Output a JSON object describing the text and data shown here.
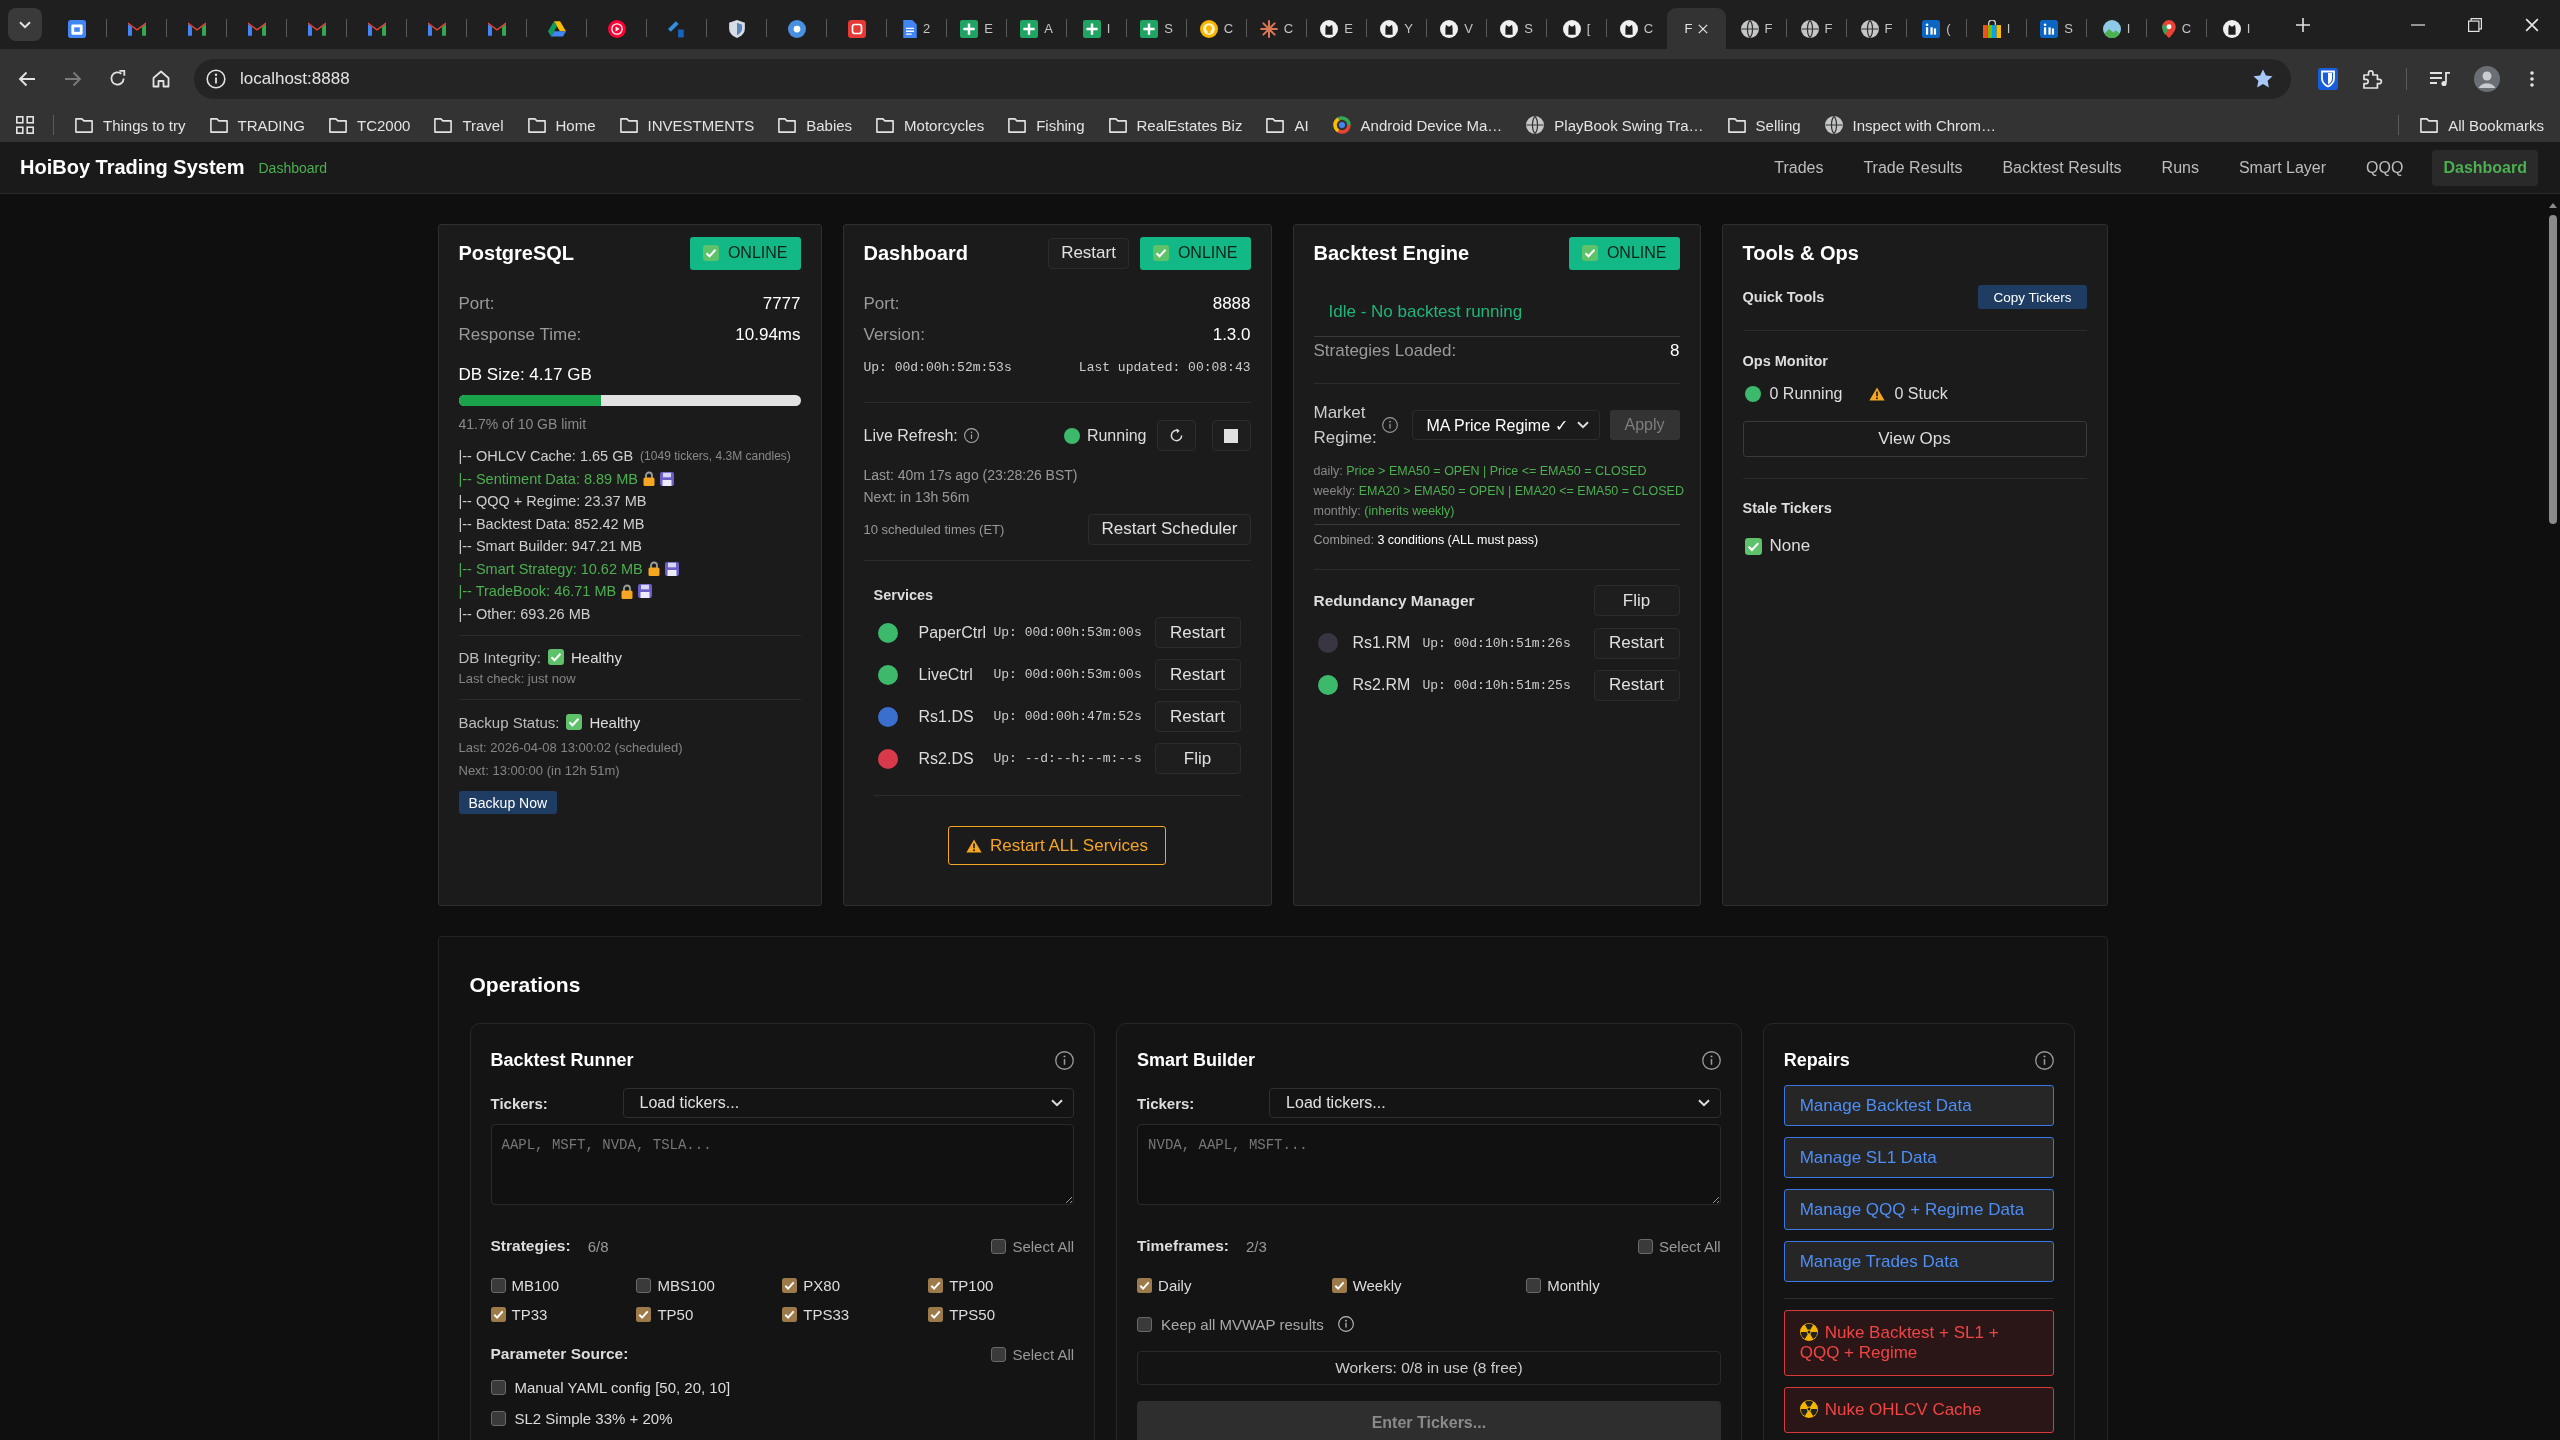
{
  "browser": {
    "tabs": [
      {
        "kind": "calendar",
        "selected": false
      },
      {
        "kind": "mail",
        "selected": false
      },
      {
        "kind": "mail",
        "selected": false
      },
      {
        "kind": "mail",
        "selected": false
      },
      {
        "kind": "mail",
        "selected": false
      },
      {
        "kind": "mail",
        "selected": false
      },
      {
        "kind": "mail",
        "selected": false
      },
      {
        "kind": "mail",
        "selected": false
      },
      {
        "kind": "triangle",
        "selected": false
      },
      {
        "kind": "play",
        "selected": false
      },
      {
        "kind": "corner",
        "selected": false
      },
      {
        "kind": "shield",
        "selected": false
      },
      {
        "kind": "disc",
        "selected": false
      },
      {
        "kind": "tile",
        "selected": false
      },
      {
        "kind": "document",
        "title": "2",
        "selected": false
      },
      {
        "kind": "sheet",
        "title": "E",
        "selected": false
      },
      {
        "kind": "sheet",
        "title": "A",
        "selected": false
      },
      {
        "kind": "sheet",
        "title": "I",
        "selected": false
      },
      {
        "kind": "sheet",
        "title": "S",
        "selected": false
      },
      {
        "kind": "bulb",
        "title": "C",
        "selected": false
      },
      {
        "kind": "sparkle",
        "title": "C",
        "selected": false
      },
      {
        "kind": "roundel",
        "title": "E",
        "selected": false
      },
      {
        "kind": "roundel",
        "title": "Y",
        "selected": false
      },
      {
        "kind": "roundel",
        "title": "V",
        "selected": false
      },
      {
        "kind": "roundel",
        "title": "S",
        "selected": false
      },
      {
        "kind": "roundel",
        "title": "[",
        "selected": false
      },
      {
        "kind": "roundel",
        "title": "C",
        "selected": false
      },
      {
        "title": "F",
        "selected": true
      },
      {
        "kind": "globe",
        "title": "F",
        "selected": false
      },
      {
        "kind": "globe",
        "title": "F",
        "selected": false
      },
      {
        "kind": "globe",
        "title": "F",
        "selected": false
      },
      {
        "kind": "box",
        "title": "(",
        "selected": false
      },
      {
        "kind": "bag",
        "title": "I",
        "selected": false
      },
      {
        "kind": "box",
        "title": "S",
        "selected": false
      },
      {
        "kind": "landscape",
        "title": "I",
        "selected": false
      },
      {
        "kind": "pin",
        "title": "C",
        "selected": false
      },
      {
        "kind": "roundel",
        "title": "I",
        "selected": false
      }
    ],
    "address": "localhost:8888",
    "bookmarks": [
      {
        "kind": "folder",
        "label": "Things to try"
      },
      {
        "kind": "folder",
        "label": "TRADING"
      },
      {
        "kind": "folder",
        "label": "TC2000"
      },
      {
        "kind": "folder",
        "label": "Travel"
      },
      {
        "kind": "folder",
        "label": "Home"
      },
      {
        "kind": "folder",
        "label": "INVESTMENTS"
      },
      {
        "kind": "folder",
        "label": "Babies"
      },
      {
        "kind": "folder",
        "label": "Motorcycles"
      },
      {
        "kind": "folder",
        "label": "Fishing"
      },
      {
        "kind": "folder",
        "label": "RealEstates Biz"
      },
      {
        "kind": "folder",
        "label": "AI"
      },
      {
        "kind": "ring",
        "label": "Android Device Ma…"
      },
      {
        "kind": "globe",
        "label": "PlayBook Swing Tra…"
      },
      {
        "kind": "folder",
        "label": "Selling"
      },
      {
        "kind": "globe",
        "label": "Inspect with Chrom…"
      }
    ],
    "all_bookmarks": {
      "kind": "folder",
      "label": "All Bookmarks"
    }
  },
  "header": {
    "title": "HoiBoy Trading System",
    "page": "Dashboard",
    "nav": [
      {
        "label": "Trades",
        "selected": false
      },
      {
        "label": "Trade Results",
        "selected": false
      },
      {
        "label": "Backtest Results",
        "selected": false
      },
      {
        "label": "Runs",
        "selected": false
      },
      {
        "label": "Smart Layer",
        "selected": false
      },
      {
        "label": "QQQ",
        "selected": false
      },
      {
        "label": "Dashboard",
        "selected": true
      }
    ]
  },
  "postgres": {
    "title": "PostgreSQL",
    "status": {
      "label": "ONLINE",
      "online": true
    },
    "stats": [
      {
        "label": "Port:",
        "value": "7777"
      },
      {
        "label": "Response Time:",
        "value": "10.94ms"
      }
    ],
    "db_size": "DB Size: 4.17 GB",
    "usage": {
      "level": 0.417,
      "caption": "41.7% of 10 GB limit"
    },
    "breakdown": [
      {
        "text": "|-- OHLCV Cache: 1.65 GB",
        "note": "(1049 tickers, 4.3M candles)",
        "protected": false
      },
      {
        "text": "|-- Sentiment Data: 8.89 MB",
        "protected": true
      },
      {
        "text": "|-- QQQ + Regime: 23.37 MB",
        "protected": false
      },
      {
        "text": "|-- Backtest Data: 852.42 MB",
        "protected": false
      },
      {
        "text": "|-- Smart Builder: 947.21 MB",
        "protected": false
      },
      {
        "text": "|-- Smart Strategy: 10.62 MB",
        "protected": true
      },
      {
        "text": "|-- TradeBook: 46.71 MB",
        "protected": true
      },
      {
        "text": "|-- Other: 693.26 MB",
        "protected": false
      }
    ],
    "integrity": {
      "label": "DB Integrity:",
      "ok": true,
      "value": "Healthy",
      "note": "Last check: just now"
    },
    "backup": {
      "label": "Backup Status:",
      "ok": true,
      "value": "Healthy",
      "lines": [
        "Last: 2026-04-08 13:00:02 (scheduled)",
        "Next: 13:00:00 (in 12h 51m)"
      ],
      "button": "Backup Now"
    }
  },
  "dashboard": {
    "title": "Dashboard",
    "restart": "Restart",
    "status": {
      "label": "ONLINE",
      "online": true
    },
    "stats": [
      {
        "label": "Port:",
        "value": "8888"
      },
      {
        "label": "Version:",
        "value": "1.3.0"
      }
    ],
    "uptime": "Up: 00d:00h:52m:53s",
    "updated": "Last updated: 00:08:43",
    "live_refresh": {
      "label": "Live Refresh:",
      "running": true,
      "state": "Running",
      "last": "Last: 40m 17s ago (23:28:26 BST)",
      "next": "Next: in 13h 56m",
      "schedule": "10 scheduled times (ET)",
      "button": "Restart Scheduler"
    },
    "services": {
      "title": "Services",
      "items": [
        {
          "name": "PaperCtrl",
          "uptime": "Up: 00d:00h:53m:00s",
          "color": "#3cb96b",
          "action": "Restart"
        },
        {
          "name": "LiveCtrl",
          "uptime": "Up: 00d:00h:53m:00s",
          "color": "#3cb96b",
          "action": "Restart"
        },
        {
          "name": "Rs1.DS",
          "uptime": "Up: 00d:00h:47m:52s",
          "color": "#3a6fd0",
          "action": "Restart"
        },
        {
          "name": "Rs2.DS",
          "uptime": "Up: --d:--h:--m:--s",
          "color": "#d93a4b",
          "action": "Flip"
        }
      ]
    },
    "restart_all": "Restart ALL Services"
  },
  "backtest_engine": {
    "title": "Backtest Engine",
    "status": {
      "label": "ONLINE",
      "online": true
    },
    "idle": "Idle - No backtest running",
    "strategies": {
      "label": "Strategies Loaded:",
      "value": "8"
    },
    "regime": {
      "label": "Market Regime:",
      "value": "MA Price Regime ✓",
      "apply": {
        "label": "Apply",
        "disabled": true
      },
      "rules": [
        {
          "label": "daily:",
          "text": "Price > EMA50 = OPEN | Price <= EMA50 = CLOSED"
        },
        {
          "label": "weekly:",
          "text": "EMA20 > EMA50 = OPEN | EMA20 <= EMA50 = CLOSED"
        },
        {
          "label": "monthly:",
          "text": "(inherits weekly)"
        }
      ],
      "combined": {
        "label": "Combined:",
        "value": "3 conditions (ALL must pass)"
      }
    },
    "redundancy": {
      "title": "Redundancy Manager",
      "action": "Flip",
      "items": [
        {
          "name": "Rs1.RM",
          "uptime": "Up: 00d:10h:51m:26s",
          "color": "#3a3542",
          "action": "Restart"
        },
        {
          "name": "Rs2.RM",
          "uptime": "Up: 00d:10h:51m:25s",
          "color": "#3cb96b",
          "action": "Restart"
        }
      ]
    }
  },
  "tools": {
    "title": "Tools & Ops",
    "quick_tools": {
      "label": "Quick Tools",
      "button": "Copy Tickers"
    },
    "ops_monitor": {
      "label": "Ops Monitor",
      "running": "0 Running",
      "stuck": "0 Stuck",
      "button": "View Ops"
    },
    "stale": {
      "label": "Stale Tickers",
      "ok": true,
      "value": "None"
    }
  },
  "operations": {
    "title": "Operations",
    "backtest_runner": {
      "title": "Backtest Runner",
      "tickers": {
        "label": "Tickers:",
        "select": "Load tickers...",
        "placeholder": "AAPL, MSFT, NVDA, TSLA..."
      },
      "strategies": {
        "label": "Strategies:",
        "count": "6/8",
        "select_all": {
          "label": "Select All",
          "checked": false
        },
        "items": [
          {
            "label": "MB100",
            "checked": false
          },
          {
            "label": "MBS100",
            "checked": false
          },
          {
            "label": "PX80",
            "checked": true
          },
          {
            "label": "TP100",
            "checked": true
          },
          {
            "label": "TP33",
            "checked": true
          },
          {
            "label": "TP50",
            "checked": true
          },
          {
            "label": "TPS33",
            "checked": true
          },
          {
            "label": "TPS50",
            "checked": true
          }
        ]
      },
      "param_source": {
        "label": "Parameter Source:",
        "select_all": {
          "label": "Select All",
          "checked": false
        },
        "items": [
          {
            "label": "Manual YAML config [50, 20, 10]",
            "checked": false
          },
          {
            "label": "SL2 Simple 33% + 20%",
            "checked": false
          }
        ]
      }
    },
    "smart_builder": {
      "title": "Smart Builder",
      "tickers": {
        "label": "Tickers:",
        "select": "Load tickers...",
        "placeholder": "NVDA, AAPL, MSFT..."
      },
      "timeframes": {
        "label": "Timeframes:",
        "count": "2/3",
        "select_all": {
          "label": "Select All",
          "checked": false
        },
        "items": [
          {
            "label": "Daily",
            "checked": true
          },
          {
            "label": "Weekly",
            "checked": true
          },
          {
            "label": "Monthly",
            "checked": false
          }
        ]
      },
      "keep_all": {
        "label": "Keep all MVWAP results",
        "checked": false
      },
      "workers": "Workers: 0/8 in use (8 free)",
      "submit": {
        "label": "Enter Tickers...",
        "disabled": true
      }
    },
    "repairs": {
      "title": "Repairs",
      "actions": [
        {
          "kind": "manage",
          "label": "Manage Backtest Data"
        },
        {
          "kind": "manage",
          "label": "Manage SL1 Data"
        },
        {
          "kind": "manage",
          "label": "Manage QQQ + Regime Data"
        },
        {
          "kind": "manage",
          "label": "Manage Trades Data"
        },
        {
          "kind": "nuke",
          "label": "Nuke Backtest + SL1 + QQQ + Regime"
        },
        {
          "kind": "nuke",
          "label": "Nuke OHLCV Cache"
        }
      ]
    }
  }
}
